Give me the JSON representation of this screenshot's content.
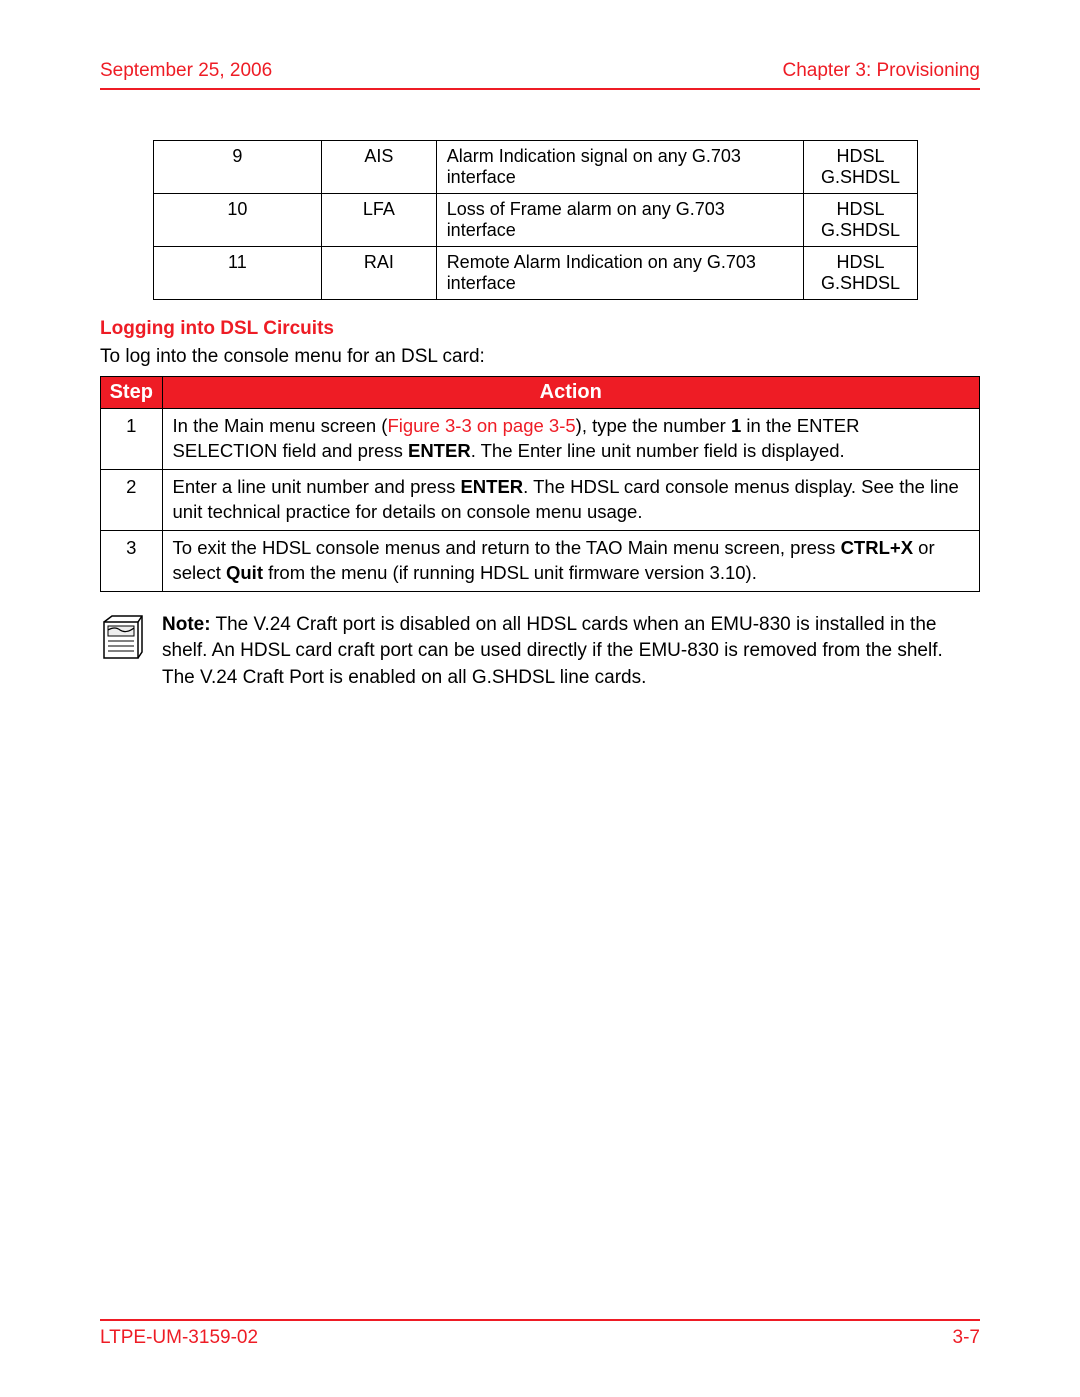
{
  "header": {
    "date": "September 25, 2006",
    "chapter": "Chapter 3: Provisioning"
  },
  "alarm_table": {
    "rows": [
      {
        "num": "9",
        "code": "AIS",
        "desc": "Alarm Indication signal on any G.703 interface",
        "types": "HDSL G.SHDSL"
      },
      {
        "num": "10",
        "code": "LFA",
        "desc": "Loss of Frame alarm on any G.703 interface",
        "types": "HDSL G.SHDSL"
      },
      {
        "num": "11",
        "code": "RAI",
        "desc": "Remote Alarm Indication on any G.703 interface",
        "types": "HDSL G.SHDSL"
      }
    ]
  },
  "section_heading": "Logging into DSL Circuits",
  "intro": "To log into the console menu for an DSL card:",
  "step_table": {
    "header": {
      "step": "Step",
      "action": "Action"
    },
    "rows": [
      {
        "num": "1",
        "parts": {
          "p1": "In the Main menu screen (",
          "xref": "Figure 3-3 on page 3-5",
          "p2": "), type the number ",
          "bold1": "1",
          "p3": " in the ENTER SELECTION field and press ",
          "bold2": "ENTER",
          "p4": ". The Enter line unit number field is displayed."
        }
      },
      {
        "num": "2",
        "parts": {
          "p1": "Enter a line unit number and press ",
          "bold1": "ENTER",
          "p2": ". The HDSL card console menus display. See the line unit technical practice for details on console menu usage."
        }
      },
      {
        "num": "3",
        "parts": {
          "p1": "To exit the HDSL console menus and return to the TAO Main menu screen, press ",
          "bold1": "CTRL+X",
          "p2": " or select ",
          "bold2": "Quit",
          "p3": " from the menu (if running HDSL unit firmware version 3.10)."
        }
      }
    ]
  },
  "note": {
    "label": "Note:",
    "text": " The V.24 Craft port is disabled on all HDSL cards when an EMU-830 is installed in the shelf.  An HDSL card craft port can be used directly if the EMU-830 is removed from the shelf. The V.24 Craft Port is enabled on all G.SHDSL line cards."
  },
  "footer": {
    "doc": "LTPE-UM-3159-02",
    "page": "3-7"
  }
}
